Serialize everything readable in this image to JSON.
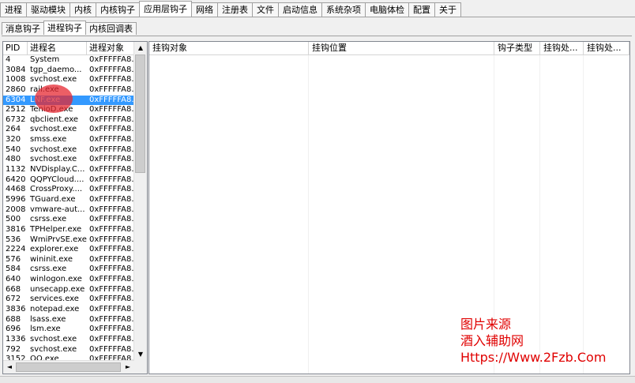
{
  "main_tabs": [
    {
      "label": "进程",
      "active": false
    },
    {
      "label": "驱动模块",
      "active": false
    },
    {
      "label": "内核",
      "active": false
    },
    {
      "label": "内核钩子",
      "active": false
    },
    {
      "label": "应用层钩子",
      "active": true
    },
    {
      "label": "网络",
      "active": false
    },
    {
      "label": "注册表",
      "active": false
    },
    {
      "label": "文件",
      "active": false
    },
    {
      "label": "启动信息",
      "active": false
    },
    {
      "label": "系统杂项",
      "active": false
    },
    {
      "label": "电脑体检",
      "active": false
    },
    {
      "label": "配置",
      "active": false
    },
    {
      "label": "关于",
      "active": false
    }
  ],
  "sub_tabs": [
    {
      "label": "消息钩子",
      "active": false
    },
    {
      "label": "进程钩子",
      "active": true
    },
    {
      "label": "内核回调表",
      "active": false
    }
  ],
  "process_table": {
    "columns": [
      "PID",
      "进程名",
      "进程对象"
    ],
    "sort_indicator": "▲",
    "rows": [
      [
        "4",
        "System",
        "0xFFFFFA8.."
      ],
      [
        "3084",
        "tgp_daemo...",
        "0xFFFFFA8.."
      ],
      [
        "1008",
        "svchost.exe",
        "0xFFFFFA8.."
      ],
      [
        "2860",
        "rail.exe",
        "0xFFFFFA8.."
      ],
      [
        "6304",
        "LNF.exe",
        "0xFFFFFA8.."
      ],
      [
        "2512",
        "TenioD.exe",
        "0xFFFFFA8.."
      ],
      [
        "6732",
        "qbclient.exe",
        "0xFFFFFA8.."
      ],
      [
        "264",
        "svchost.exe",
        "0xFFFFFA8.."
      ],
      [
        "320",
        "smss.exe",
        "0xFFFFFA8.."
      ],
      [
        "540",
        "svchost.exe",
        "0xFFFFFA8.."
      ],
      [
        "480",
        "svchost.exe",
        "0xFFFFFA8.."
      ],
      [
        "1132",
        "NVDisplay.C...",
        "0xFFFFFA8.."
      ],
      [
        "6420",
        "QQPYCloud....",
        "0xFFFFFA8.."
      ],
      [
        "4468",
        "CrossProxy....",
        "0xFFFFFA8.."
      ],
      [
        "5996",
        "TGuard.exe",
        "0xFFFFFA8.."
      ],
      [
        "2008",
        "vmware-aut...",
        "0xFFFFFA8.."
      ],
      [
        "500",
        "csrss.exe",
        "0xFFFFFA8.."
      ],
      [
        "3816",
        "TPHelper.exe",
        "0xFFFFFA8.."
      ],
      [
        "536",
        "WmiPrvSE.exe",
        "0xFFFFFA8.."
      ],
      [
        "2224",
        "explorer.exe",
        "0xFFFFFA8.."
      ],
      [
        "576",
        "wininit.exe",
        "0xFFFFFA8.."
      ],
      [
        "584",
        "csrss.exe",
        "0xFFFFFA8.."
      ],
      [
        "640",
        "winlogon.exe",
        "0xFFFFFA8.."
      ],
      [
        "668",
        "unsecapp.exe",
        "0xFFFFFA8.."
      ],
      [
        "672",
        "services.exe",
        "0xFFFFFA8.."
      ],
      [
        "3836",
        "notepad.exe",
        "0xFFFFFA8.."
      ],
      [
        "688",
        "lsass.exe",
        "0xFFFFFA8.."
      ],
      [
        "696",
        "lsm.exe",
        "0xFFFFFA8.."
      ],
      [
        "1336",
        "svchost.exe",
        "0xFFFFFA8.."
      ],
      [
        "792",
        "svchost.exe",
        "0xFFFFFA8.."
      ],
      [
        "3152",
        "QQ.exe",
        "0xFFFFFA8.."
      ]
    ],
    "selected_index": 4
  },
  "hook_table": {
    "columns": [
      "挂钩对象",
      "挂钩位置",
      "钩子类型",
      "挂钩处...",
      "挂钩处..."
    ]
  },
  "scroll_glyphs": {
    "up": "▲",
    "down": "▼",
    "left": "◄",
    "right": "►"
  },
  "watermark": {
    "line1": "图片来源",
    "line2": "酒入辅助网",
    "line3": "Https://Www.2Fzb.Com"
  },
  "colors": {
    "selection": "#3399ff",
    "watermark": "#e00000"
  }
}
